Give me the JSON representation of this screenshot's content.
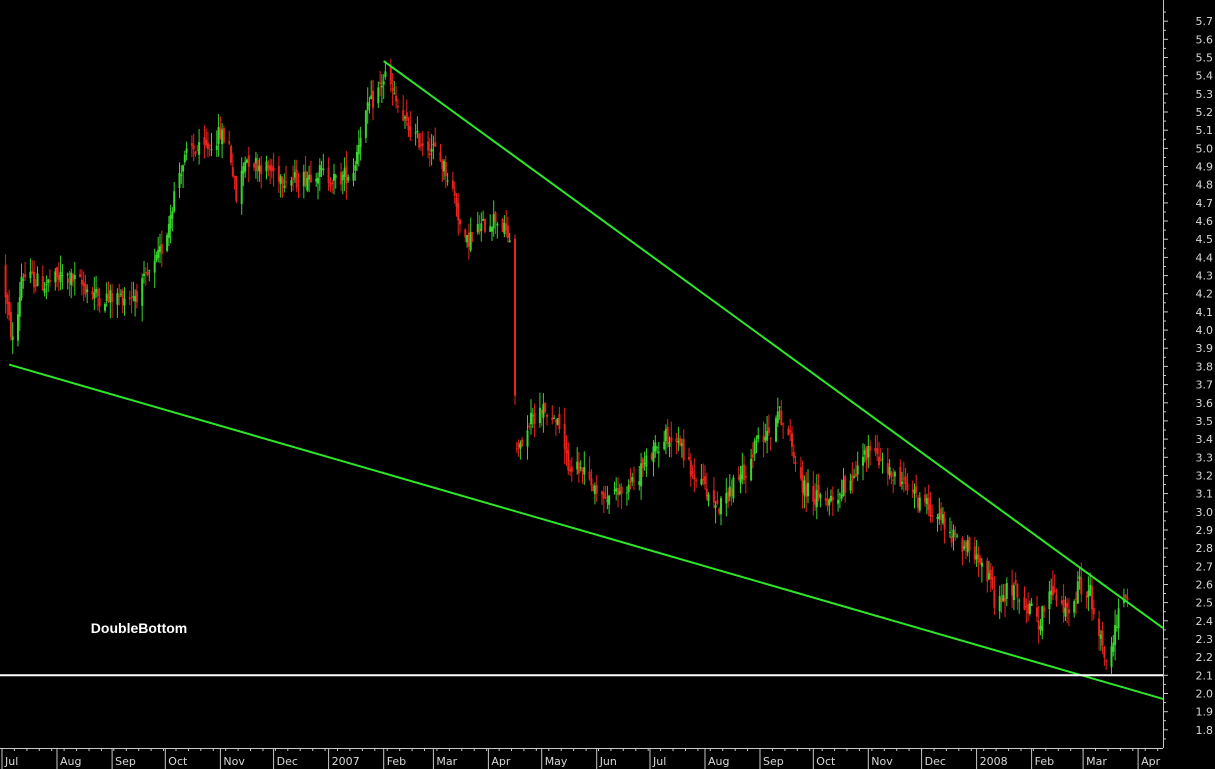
{
  "colors": {
    "background": "#000000",
    "up": "#39d42e",
    "down": "#e8231e",
    "trendline": "#2ee62a",
    "support": "#ffffff",
    "axis": "#c8c8c8",
    "text": "#d8d8d8"
  },
  "chart_data": {
    "type": "candlestick",
    "title": "",
    "xlabel": "",
    "ylabel": "",
    "ylim": [
      1.7,
      5.8
    ],
    "y_axis_side": "right",
    "grid": false,
    "legend": "none",
    "y_ticks": [
      1.8,
      1.9,
      2.0,
      2.1,
      2.2,
      2.3,
      2.4,
      2.5,
      2.6,
      2.7,
      2.8,
      2.9,
      3.0,
      3.1,
      3.2,
      3.3,
      3.4,
      3.5,
      3.6,
      3.7,
      3.8,
      3.9,
      4.0,
      4.1,
      4.2,
      4.3,
      4.4,
      4.5,
      4.6,
      4.7,
      4.8,
      4.9,
      5.0,
      5.1,
      5.2,
      5.3,
      5.4,
      5.5,
      5.6,
      5.7
    ],
    "x_start": "2006-07-01",
    "x_end": "2008-04-15",
    "x_labels": [
      {
        "date": "2006-07-01",
        "label": "Jul"
      },
      {
        "date": "2006-08-01",
        "label": "Aug"
      },
      {
        "date": "2006-09-01",
        "label": "Sep"
      },
      {
        "date": "2006-10-01",
        "label": "Oct"
      },
      {
        "date": "2006-11-01",
        "label": "Nov"
      },
      {
        "date": "2006-12-01",
        "label": "Dec"
      },
      {
        "date": "2007-01-01",
        "label": "2007"
      },
      {
        "date": "2007-02-01",
        "label": "Feb"
      },
      {
        "date": "2007-03-01",
        "label": "Mar"
      },
      {
        "date": "2007-04-01",
        "label": "Apr"
      },
      {
        "date": "2007-05-01",
        "label": "May"
      },
      {
        "date": "2007-06-01",
        "label": "Jun"
      },
      {
        "date": "2007-07-01",
        "label": "Jul"
      },
      {
        "date": "2007-08-01",
        "label": "Aug"
      },
      {
        "date": "2007-09-01",
        "label": "Sep"
      },
      {
        "date": "2007-10-01",
        "label": "Oct"
      },
      {
        "date": "2007-11-01",
        "label": "Nov"
      },
      {
        "date": "2007-12-01",
        "label": "Dec"
      },
      {
        "date": "2008-01-01",
        "label": "2008"
      },
      {
        "date": "2008-02-01",
        "label": "Feb"
      },
      {
        "date": "2008-03-01",
        "label": "Mar"
      },
      {
        "date": "2008-04-01",
        "label": "Apr"
      }
    ],
    "price_path": [
      [
        "2006-07-01",
        4.35
      ],
      [
        "2006-07-05",
        4.05
      ],
      [
        "2006-07-08",
        3.88
      ],
      [
        "2006-07-12",
        4.3
      ],
      [
        "2006-07-18",
        4.28
      ],
      [
        "2006-07-25",
        4.25
      ],
      [
        "2006-08-05",
        4.3
      ],
      [
        "2006-08-15",
        4.25
      ],
      [
        "2006-08-25",
        4.18
      ],
      [
        "2006-09-05",
        4.18
      ],
      [
        "2006-09-15",
        4.2
      ],
      [
        "2006-09-25",
        4.35
      ],
      [
        "2006-10-01",
        4.5
      ],
      [
        "2006-10-08",
        4.85
      ],
      [
        "2006-10-15",
        5.0
      ],
      [
        "2006-10-22",
        4.98
      ],
      [
        "2006-11-01",
        5.08
      ],
      [
        "2006-11-06",
        5.02
      ],
      [
        "2006-11-10",
        4.72
      ],
      [
        "2006-11-15",
        4.95
      ],
      [
        "2006-11-25",
        4.9
      ],
      [
        "2006-12-05",
        4.85
      ],
      [
        "2006-12-15",
        4.82
      ],
      [
        "2006-12-25",
        4.88
      ],
      [
        "2007-01-05",
        4.82
      ],
      [
        "2007-01-15",
        4.88
      ],
      [
        "2007-01-20",
        5.15
      ],
      [
        "2007-01-28",
        5.3
      ],
      [
        "2007-02-03",
        5.42
      ],
      [
        "2007-02-06",
        5.3
      ],
      [
        "2007-02-12",
        5.15
      ],
      [
        "2007-02-20",
        5.05
      ],
      [
        "2007-03-01",
        5.0
      ],
      [
        "2007-03-08",
        4.88
      ],
      [
        "2007-03-14",
        4.7
      ],
      [
        "2007-03-18",
        4.45
      ],
      [
        "2007-03-22",
        4.52
      ],
      [
        "2007-03-30",
        4.58
      ],
      [
        "2007-04-05",
        4.62
      ],
      [
        "2007-04-10",
        4.55
      ],
      [
        "2007-04-13",
        4.5
      ],
      [
        "2007-04-17",
        3.3
      ],
      [
        "2007-04-22",
        3.45
      ],
      [
        "2007-04-30",
        3.58
      ],
      [
        "2007-05-05",
        3.55
      ],
      [
        "2007-05-10",
        3.48
      ],
      [
        "2007-05-15",
        3.28
      ],
      [
        "2007-05-25",
        3.2
      ],
      [
        "2007-06-01",
        3.08
      ],
      [
        "2007-06-10",
        3.08
      ],
      [
        "2007-06-20",
        3.15
      ],
      [
        "2007-07-01",
        3.3
      ],
      [
        "2007-07-10",
        3.42
      ],
      [
        "2007-07-18",
        3.38
      ],
      [
        "2007-07-25",
        3.2
      ],
      [
        "2007-08-01",
        3.12
      ],
      [
        "2007-08-08",
        3.02
      ],
      [
        "2007-08-15",
        3.12
      ],
      [
        "2007-08-25",
        3.25
      ],
      [
        "2007-09-01",
        3.42
      ],
      [
        "2007-09-07",
        3.45
      ],
      [
        "2007-09-12",
        3.55
      ],
      [
        "2007-09-18",
        3.4
      ],
      [
        "2007-09-25",
        3.15
      ],
      [
        "2007-10-05",
        3.05
      ],
      [
        "2007-10-15",
        3.1
      ],
      [
        "2007-10-25",
        3.22
      ],
      [
        "2007-11-01",
        3.35
      ],
      [
        "2007-11-10",
        3.25
      ],
      [
        "2007-11-20",
        3.15
      ],
      [
        "2007-12-01",
        3.05
      ],
      [
        "2007-12-10",
        3.0
      ],
      [
        "2007-12-20",
        2.85
      ],
      [
        "2007-12-28",
        2.8
      ],
      [
        "2008-01-05",
        2.75
      ],
      [
        "2008-01-12",
        2.45
      ],
      [
        "2008-01-20",
        2.6
      ],
      [
        "2008-01-28",
        2.5
      ],
      [
        "2008-02-05",
        2.4
      ],
      [
        "2008-02-12",
        2.55
      ],
      [
        "2008-02-20",
        2.45
      ],
      [
        "2008-02-28",
        2.6
      ],
      [
        "2008-03-05",
        2.55
      ],
      [
        "2008-03-10",
        2.35
      ],
      [
        "2008-03-15",
        2.15
      ],
      [
        "2008-03-19",
        2.35
      ],
      [
        "2008-03-23",
        2.5
      ],
      [
        "2008-03-26",
        2.48
      ]
    ],
    "trendlines": [
      {
        "kind": "resistance",
        "from": {
          "date": "2007-02-01",
          "value": 5.48
        },
        "to": {
          "date": "2008-04-15",
          "value": 2.36
        }
      },
      {
        "kind": "support",
        "from": {
          "date": "2006-07-05",
          "value": 3.81
        },
        "to": {
          "date": "2008-04-15",
          "value": 1.97
        }
      }
    ],
    "horizontal_lines": [
      {
        "value": 2.1,
        "color": "#ffffff"
      }
    ],
    "annotations": [
      {
        "text": "DoubleBottom",
        "date": "2006-08-20",
        "value": 2.36
      }
    ]
  }
}
